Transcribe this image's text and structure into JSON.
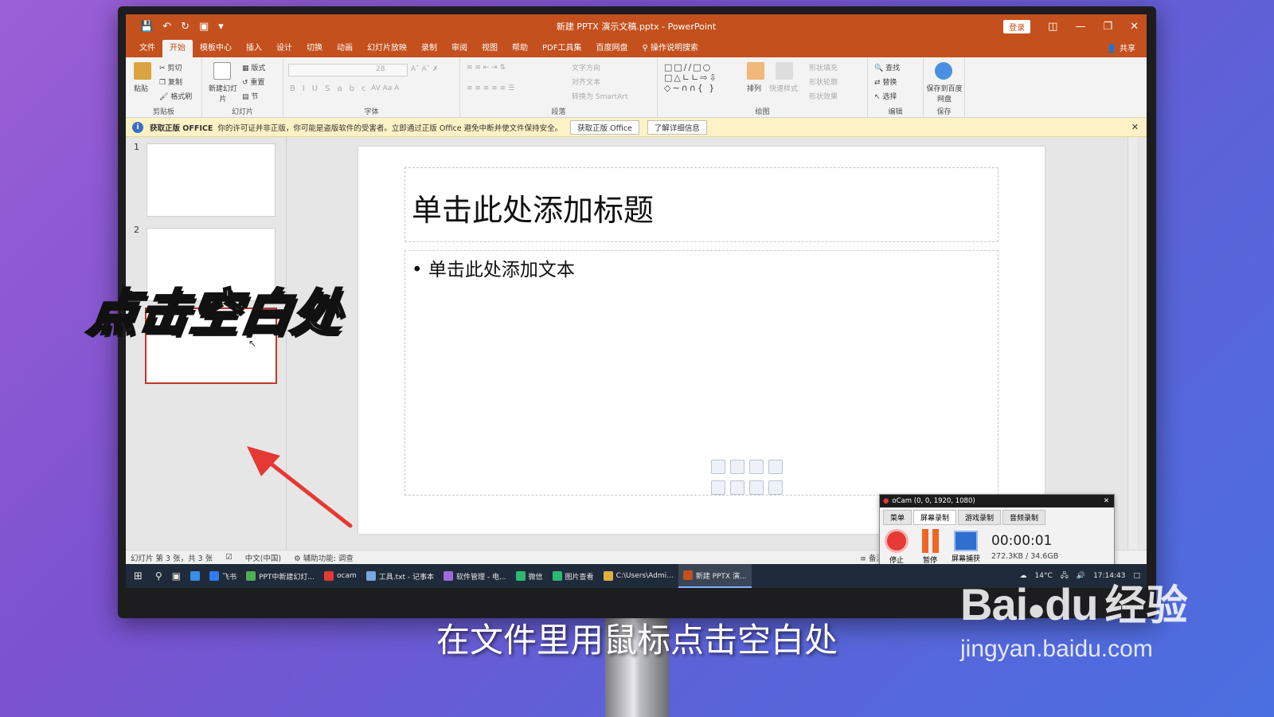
{
  "window": {
    "title": "新建 PPTX 演示文稿.pptx - PowerPoint",
    "login_label": "登录",
    "share_label": "共享"
  },
  "tabs": [
    "文件",
    "开始",
    "模板中心",
    "插入",
    "设计",
    "切换",
    "动画",
    "幻灯片放映",
    "录制",
    "审阅",
    "视图",
    "帮助",
    "PDF工具集",
    "百度网盘"
  ],
  "active_tab_index": 1,
  "tell_me": "操作说明搜索",
  "ribbon": {
    "clipboard": {
      "paste": "粘贴",
      "cut": "剪切",
      "copy": "复制",
      "format_painter": "格式刷",
      "label": "剪贴板"
    },
    "slides": {
      "new_slide": "新建幻灯片",
      "layout": "版式",
      "reset": "重置",
      "section": "节",
      "label": "幻灯片"
    },
    "font": {
      "size": "28",
      "label": "字体"
    },
    "paragraph": {
      "text_direction": "文字方向",
      "align_text": "对齐文本",
      "convert_smartart": "转换为 SmartArt",
      "label": "段落"
    },
    "drawing": {
      "arrange": "排列",
      "quick_styles": "快速样式",
      "shape_fill": "形状填充",
      "shape_outline": "形状轮廓",
      "shape_effects": "形状效果",
      "label": "绘图"
    },
    "editing": {
      "find": "查找",
      "replace": "替换",
      "select": "选择",
      "label": "编辑"
    },
    "save": {
      "save_to": "保存到百度网盘",
      "label": "保存"
    }
  },
  "notice": {
    "heading": "获取正版 OFFICE",
    "text": "你的许可证并非正版，你可能是盗版软件的受害者。立即通过正版 Office 避免中断并使文件保持安全。",
    "btn_get": "获取正版 Office",
    "btn_more": "了解详细信息"
  },
  "slides_panel": {
    "numbers": [
      "1",
      "2"
    ]
  },
  "slide": {
    "title_placeholder": "单击此处添加标题",
    "body_placeholder": "单击此处添加文本"
  },
  "statusbar": {
    "slide_info": "幻灯片 第 3 张，共 3 张",
    "language": "中文(中国)",
    "accessibility": "辅助功能: 调查",
    "notes": "备注"
  },
  "ime": {
    "label": "中"
  },
  "ocam": {
    "title": "oCam (0, 0, 1920, 1080)",
    "tabs": [
      "菜单",
      "屏幕录制",
      "游戏录制",
      "音频录制"
    ],
    "stop": "停止",
    "pause": "暂停",
    "capture": "屏幕捕获",
    "timer": "00:00:01",
    "size": "272.3KB / 34.6GB"
  },
  "taskbar": {
    "items": [
      "飞书",
      "PPT中新建幻灯...",
      "ocam",
      "工具.txt - 记事本",
      "软件管理 - 电...",
      "微信",
      "图片查看",
      "C:\\Users\\Admi...",
      "新建 PPTX 演..."
    ],
    "active_index": 8,
    "temp": "14°C",
    "time": "17:14:43"
  },
  "overlay_title": "点击空白处",
  "subtitle": "在文件里用鼠标点击空白处",
  "watermark": {
    "brand": "Bai",
    "brand2": "du",
    "cn": "经验",
    "url": "jingyan.baidu.com"
  },
  "colors": {
    "accent": "#c4501e",
    "selected_border": "#c0392b",
    "arrow": "#e53935"
  }
}
